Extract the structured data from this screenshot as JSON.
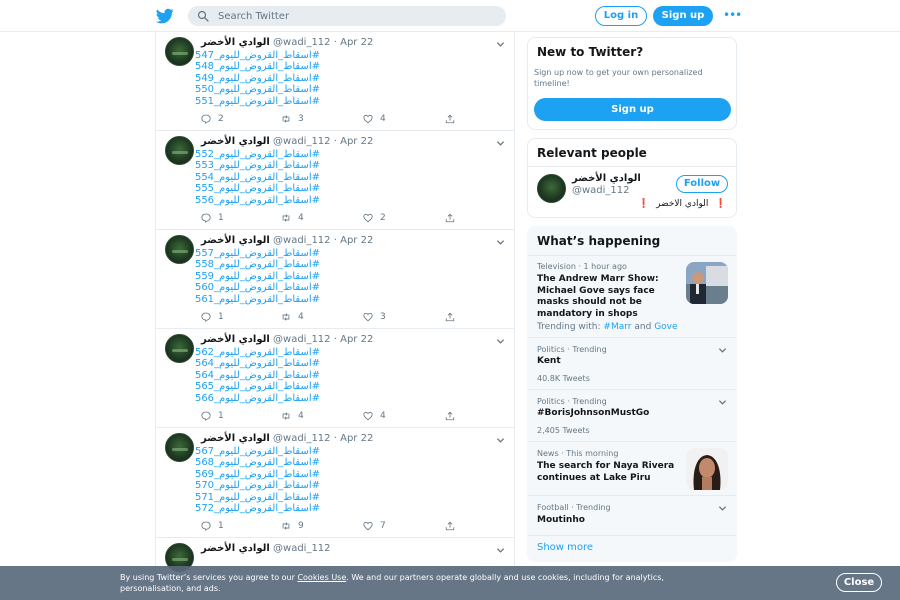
{
  "header": {
    "search_placeholder": "Search Twitter",
    "login_label": "Log in",
    "signup_label": "Sign up",
    "more_label": "•••"
  },
  "tweets": [
    {
      "name": "الوادي الأخضر",
      "handle": "@wadi_112",
      "sep": "·",
      "date": "Apr 22",
      "lines": [
        "#اسقاط_القروض_لليوم_547",
        "#اسقاط_القروض_لليوم_548",
        "#اسقاط_القروض_لليوم_549",
        "#اسقاط_القروض_لليوم_550",
        "#اسقاط_القروض_لليوم_551"
      ],
      "replies": "2",
      "retweets": "3",
      "likes": "4"
    },
    {
      "name": "الوادي الأخضر",
      "handle": "@wadi_112",
      "sep": "·",
      "date": "Apr 22",
      "lines": [
        "#اسقاط_القروض_لليوم_552",
        "#اسقاط_القروض_لليوم_553",
        "#اسقاط_القروض_لليوم_554",
        "#اسقاط_القروض_لليوم_555",
        "#اسقاط_القروض_لليوم_556"
      ],
      "replies": "1",
      "retweets": "4",
      "likes": "2"
    },
    {
      "name": "الوادي الأخضر",
      "handle": "@wadi_112",
      "sep": "·",
      "date": "Apr 22",
      "lines": [
        "#اسقاط_القروض_لليوم_557",
        "#اسقاط_القروض_لليوم_558",
        "#اسقاط_القروض_لليوم_559",
        "#اسقاط_القروض_لليوم_560",
        "#اسقاط_القروض_لليوم_561"
      ],
      "replies": "1",
      "retweets": "4",
      "likes": "3"
    },
    {
      "name": "الوادي الأخضر",
      "handle": "@wadi_112",
      "sep": "·",
      "date": "Apr 22",
      "lines": [
        "#اسقاط_القروض_لليوم_562",
        "#اسقاط_القروض_لليوم_564",
        "#اسقاط_القروض_لليوم_564",
        "#اسقاط_القروض_لليوم_565",
        "#اسقاط_القروض_لليوم_566"
      ],
      "replies": "1",
      "retweets": "4",
      "likes": "4"
    },
    {
      "name": "الوادي الأخضر",
      "handle": "@wadi_112",
      "sep": "·",
      "date": "Apr 22",
      "lines": [
        "#اسقاط_القروض_لليوم_567",
        "#اسقاط_القروض_لليوم_568",
        "#اسقاط_القروض_لليوم_569",
        "#اسقاط_القروض_لليوم_570",
        "#اسقاط_القروض_لليوم_571",
        "#اسقاط_القروض_لليوم_572"
      ],
      "replies": "1",
      "retweets": "9",
      "likes": "7"
    },
    {
      "name": "الوادي الأخضر",
      "handle": "@wadi_112",
      "sep": "",
      "date": "",
      "lines": [],
      "replies": "",
      "retweets": "",
      "likes": ""
    }
  ],
  "new_to_twitter": {
    "title": "New to Twitter?",
    "text": "Sign up now to get your own personalized timeline!",
    "button": "Sign up"
  },
  "relevant": {
    "title": "Relevant people",
    "name": "الوادي الأخضر",
    "handle": "@wadi_112",
    "follow": "Follow",
    "bio_mark": "❗",
    "bio_text": "الوادي الاخضر"
  },
  "happening": {
    "title": "What’s happening",
    "items": [
      {
        "meta": "Television · 1 hour ago",
        "title": "The Andrew Marr Show: Michael Gove says face masks should not be mandatory in shops",
        "sub_prefix": "Trending with:",
        "tag1": "#Marr",
        "and": "and",
        "tag2": "Gove"
      },
      {
        "meta": "Politics · Trending",
        "title": "Kent",
        "count": "40.8K Tweets"
      },
      {
        "meta": "Politics · Trending",
        "title": "#BorisJohnsonMustGo",
        "count": "2,405 Tweets"
      },
      {
        "meta": "News · This morning",
        "title": "The search for Naya Rivera continues at Lake Piru"
      },
      {
        "meta": "Football · Trending",
        "title": "Moutinho"
      }
    ],
    "show_more": "Show more"
  },
  "cookie": {
    "text_before": "By using Twitter’s services you agree to our",
    "link": "Cookies Use",
    "text_after": ". We and our partners operate globally and use cookies, including for analytics, personalisation, and ads.",
    "close": "Close"
  },
  "colors": {
    "accent": "#1da1f2",
    "text": "#14171a",
    "muted": "#657786",
    "border": "#e6ecf0"
  }
}
